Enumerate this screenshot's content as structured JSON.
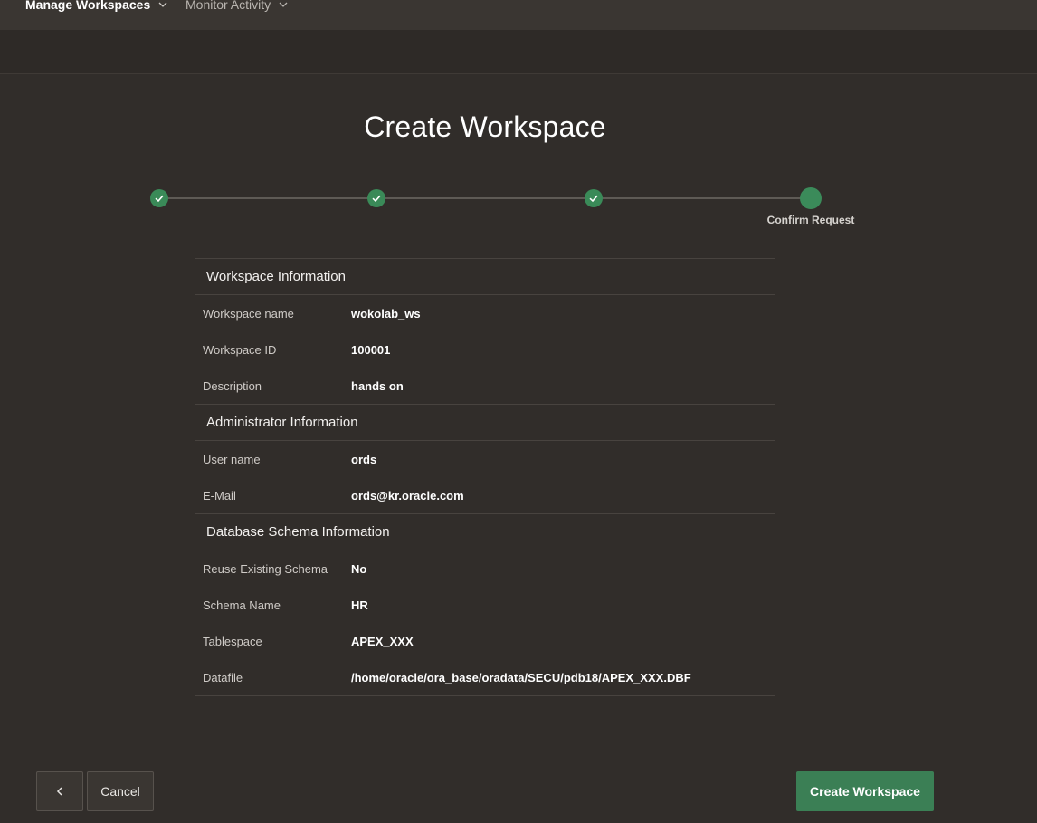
{
  "nav": {
    "manage_label": "Manage Workspaces",
    "monitor_label": "Monitor Activity"
  },
  "page": {
    "title": "Create Workspace"
  },
  "wizard": {
    "current_step_label": "Confirm Request",
    "steps_completed": 3,
    "steps_total": 4
  },
  "sections": {
    "workspace": {
      "title": "Workspace Information",
      "rows": [
        {
          "label": "Workspace name",
          "value": "wokolab_ws"
        },
        {
          "label": "Workspace ID",
          "value": "100001"
        },
        {
          "label": "Description",
          "value": "hands on"
        }
      ]
    },
    "admin": {
      "title": "Administrator Information",
      "rows": [
        {
          "label": "User name",
          "value": "ords"
        },
        {
          "label": "E-Mail",
          "value": "ords@kr.oracle.com"
        }
      ]
    },
    "schema": {
      "title": "Database Schema Information",
      "rows": [
        {
          "label": "Reuse Existing Schema",
          "value": "No"
        },
        {
          "label": "Schema Name",
          "value": "HR"
        },
        {
          "label": "Tablespace",
          "value": "APEX_XXX"
        },
        {
          "label": "Datafile",
          "value": "/home/oracle/ora_base/oradata/SECU/pdb18/APEX_XXX.DBF"
        }
      ]
    }
  },
  "buttons": {
    "cancel_label": "Cancel",
    "create_label": "Create Workspace"
  },
  "colors": {
    "accent": "#3a8a58",
    "background": "#312d2a"
  }
}
